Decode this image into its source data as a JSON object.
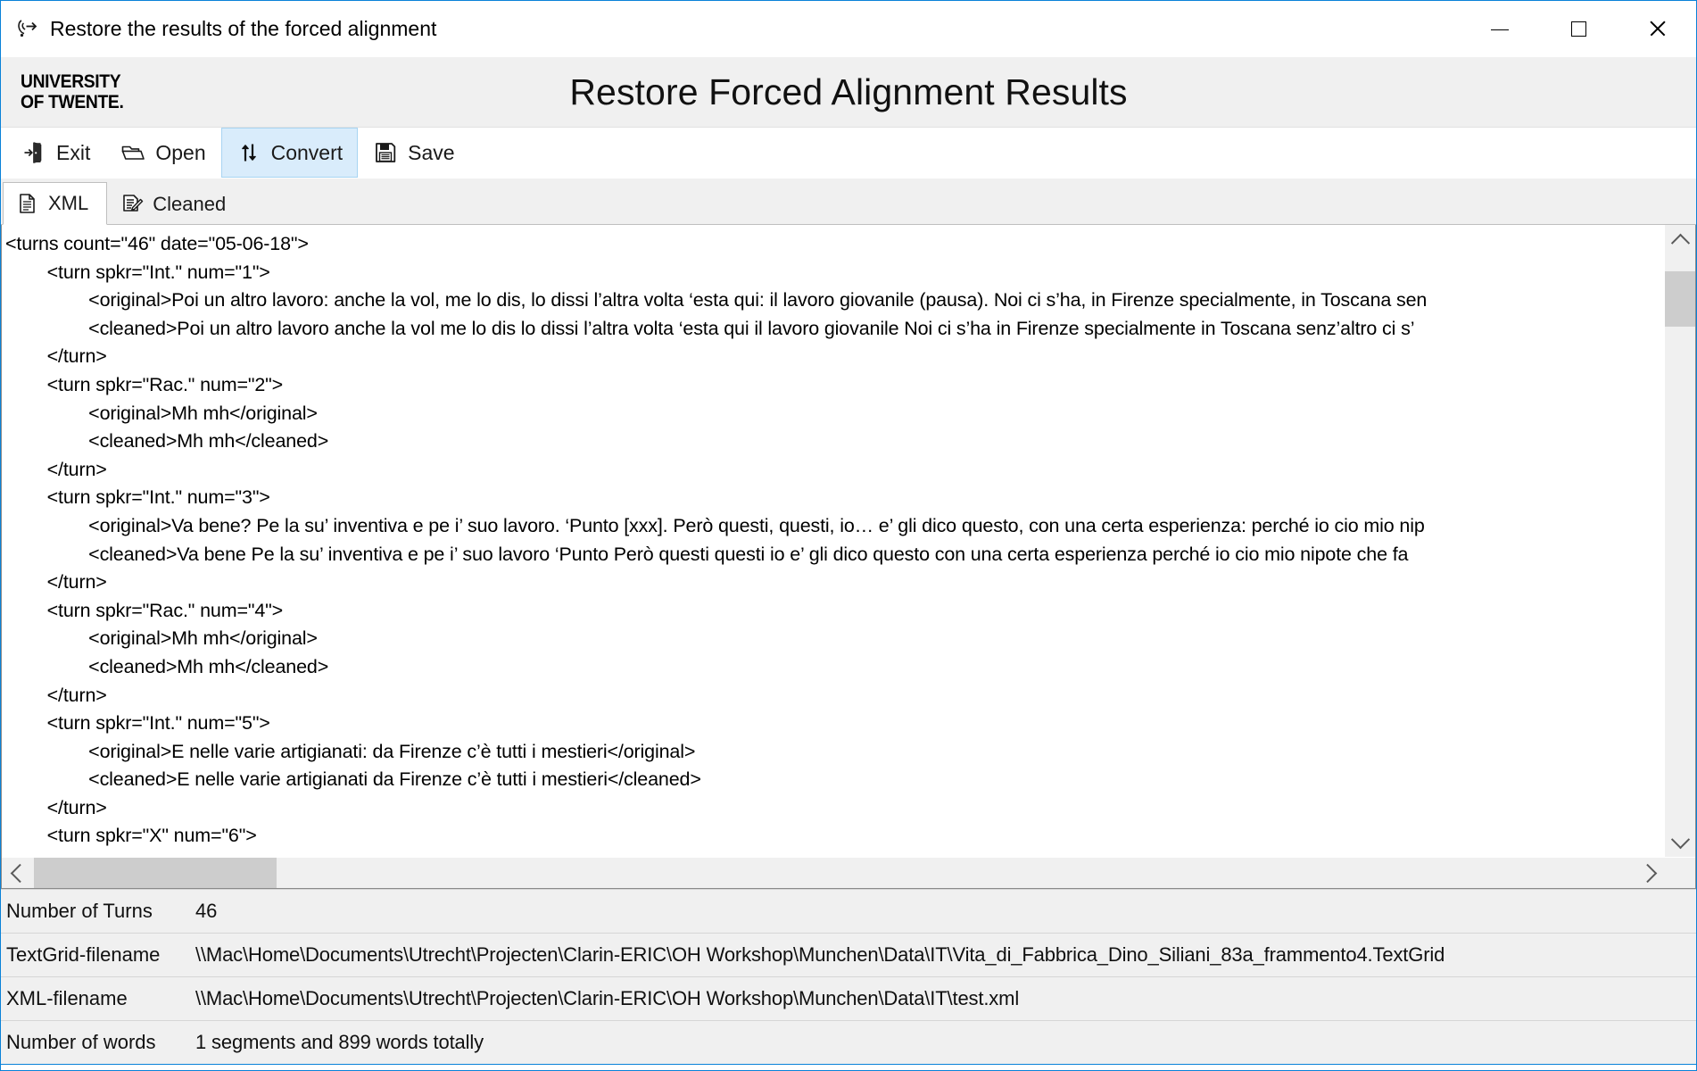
{
  "window": {
    "title": "Restore the results of the forced alignment",
    "app_icon": "speech-recognition-icon",
    "controls": {
      "minimize": "minimize-button",
      "maximize": "maximize-button",
      "close": "close-button"
    }
  },
  "banner": {
    "logo_line1": "UNIVERSITY",
    "logo_line2": "OF TWENTE.",
    "title": "Restore Forced Alignment Results"
  },
  "toolbar": {
    "buttons": [
      {
        "label": "Exit",
        "icon": "exit-door-icon",
        "active": false
      },
      {
        "label": "Open",
        "icon": "open-folder-icon",
        "active": false
      },
      {
        "label": "Convert",
        "icon": "convert-updown-arrows-icon",
        "active": true
      },
      {
        "label": "Save",
        "icon": "floppy-disk-icon",
        "active": false
      }
    ]
  },
  "tabs": [
    {
      "label": "XML",
      "icon": "document-icon",
      "selected": true
    },
    {
      "label": "Cleaned",
      "icon": "document-edit-icon",
      "selected": false
    }
  ],
  "editor": {
    "lines": [
      "<turns count=\"46\" date=\"05-06-18\">",
      "        <turn spkr=\"Int.\" num=\"1\">",
      "                <original>Poi un altro lavoro: anche la vol, me lo dis, lo dissi l’altra volta ‘esta qui: il lavoro giovanile (pausa). Noi ci s’ha, in Firenze specialmente, in Toscana sen",
      "                <cleaned>Poi un altro lavoro anche la vol me lo dis lo dissi l’altra volta ‘esta qui il lavoro giovanile Noi ci s’ha in Firenze specialmente in Toscana senz’altro ci s’",
      "        </turn>",
      "        <turn spkr=\"Rac.\" num=\"2\">",
      "                <original>Mh mh</original>",
      "                <cleaned>Mh mh</cleaned>",
      "        </turn>",
      "        <turn spkr=\"Int.\" num=\"3\">",
      "                <original>Va bene? Pe la su’ inventiva e pe i’ suo lavoro. ‘Punto [xxx]. Però questi, questi, io… e’ gli dico questo, con una certa esperienza: perché io cio mio nip",
      "                <cleaned>Va bene Pe la su’ inventiva e pe i’ suo lavoro ‘Punto Però questi questi io e’ gli dico questo con una certa esperienza perché io cio mio nipote che fa",
      "        </turn>",
      "        <turn spkr=\"Rac.\" num=\"4\">",
      "                <original>Mh mh</original>",
      "                <cleaned>Mh mh</cleaned>",
      "        </turn>",
      "        <turn spkr=\"Int.\" num=\"5\">",
      "                <original>E nelle varie artigianati: da Firenze c’è tutti i mestieri</original>",
      "                <cleaned>E nelle varie artigianati da Firenze c’è tutti i mestieri</cleaned>",
      "        </turn>",
      "        <turn spkr=\"X\" num=\"6\">"
    ]
  },
  "scrollbars": {
    "vertical": {
      "up": "scroll-up-arrow",
      "down": "scroll-down-arrow"
    },
    "horizontal": {
      "left": "scroll-left-arrow",
      "right": "scroll-right-arrow"
    }
  },
  "info": {
    "rows": [
      {
        "key": "Number of Turns",
        "value": "46"
      },
      {
        "key": "TextGrid-filename",
        "value": "\\\\Mac\\Home\\Documents\\Utrecht\\Projecten\\Clarin-ERIC\\OH Workshop\\Munchen\\Data\\IT\\Vita_di_Fabbrica_Dino_Siliani_83a_frammento4.TextGrid"
      },
      {
        "key": "XML-filename",
        "value": "\\\\Mac\\Home\\Documents\\Utrecht\\Projecten\\Clarin-ERIC\\OH Workshop\\Munchen\\Data\\IT\\test.xml"
      },
      {
        "key": "Number of words",
        "value": "1 segments and 899 words totally"
      }
    ]
  },
  "colors": {
    "window_border": "#0a82d8",
    "banner_bg": "#f0f0f0",
    "active_tool_bg": "#d9ecfb",
    "scroll_thumb": "#cdcdcd"
  }
}
